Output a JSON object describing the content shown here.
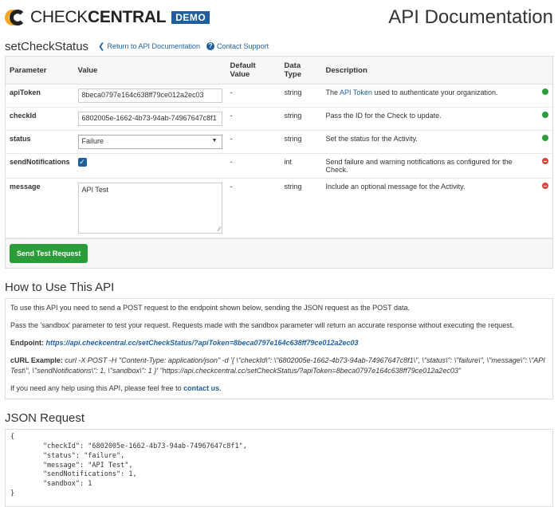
{
  "header": {
    "logo_check": "CHECK",
    "logo_central": "CENTRAL",
    "logo_badge": "DEMO",
    "page_title": "API Documentation"
  },
  "subheader": {
    "section_title": "setCheckStatus",
    "return_link": "Return to API Documentation",
    "support_link": "Contact Support"
  },
  "table": {
    "headers": [
      "Parameter",
      "Value",
      "Default Value",
      "Data Type",
      "Description"
    ],
    "rows": [
      {
        "name": "apiToken",
        "value": "8beca0797e164c638ff79ce012a2ec03",
        "default": "-",
        "type": "string",
        "desc_pre": "The ",
        "desc_link": "API Token",
        "desc_post": " used to authenticate your organization.",
        "status": "required"
      },
      {
        "name": "checkId",
        "value": "6802005e-1662-4b73-94ab-74967647c8f1",
        "default": "-",
        "type": "string",
        "desc": "Pass the ID for the Check to update.",
        "status": "required"
      },
      {
        "name": "status",
        "value": "Failure",
        "default": "-",
        "type": "string",
        "desc": "Set the status for the Activity.",
        "status": "required"
      },
      {
        "name": "sendNotifications",
        "value": "checked",
        "default": "-",
        "type": "int",
        "desc": "Send failure and warning notifications as configured for the Check.",
        "status": "optional"
      },
      {
        "name": "message",
        "value": "API Test",
        "default": "-",
        "type": "string",
        "desc": "Include an optional message for the Activity.",
        "status": "optional"
      }
    ]
  },
  "send_button": "Send Test Request",
  "howto": {
    "title": "How to Use This API",
    "p1": "To use this API you need to send a POST request to the endpoint shown below, sending the JSON request as the POST data.",
    "p2": "Pass the 'sandbox' parameter to test your request. Requests made with the sandbox parameter will return an accurate response without executing the request.",
    "endpoint_label": "Endpoint:",
    "endpoint_url": "https://api.checkcentral.cc/setCheckStatus/?apiToken=8beca0797e164c638ff79ce012a2ec03",
    "curl_label": "cURL Example:",
    "curl_text": "curl -X POST -H \"Content-Type: application/json\" -d '{ \\\"checkId\\\": \\\"6802005e-1662-4b73-94ab-74967647c8f1\\\", \\\"status\\\": \\\"failure\\\", \\\"message\\\": \\\"API Test\\\", \\\"sendNotifications\\\": 1, \\\"sandbox\\\": 1 }' \"https://api.checkcentral.cc/setCheckStatus/?apiToken=8beca0797e164c638ff79ce012a2ec03\"",
    "help_pre": "If you need any help using this API, please feel free to ",
    "help_link": "contact us",
    "help_post": "."
  },
  "json_request": {
    "title": "JSON Request",
    "body": "{\n        \"checkId\": \"6802005e-1662-4b73-94ab-74967647c8f1\",\n        \"status\": \"failure\",\n        \"message\": \"API Test\",\n        \"sendNotifications\": 1,\n        \"sandbox\": 1\n}"
  },
  "colors": {
    "accent": "#1f5f9e",
    "success": "#2a9d3a",
    "danger": "#d9463a",
    "logo_orange": "#f5a623"
  }
}
